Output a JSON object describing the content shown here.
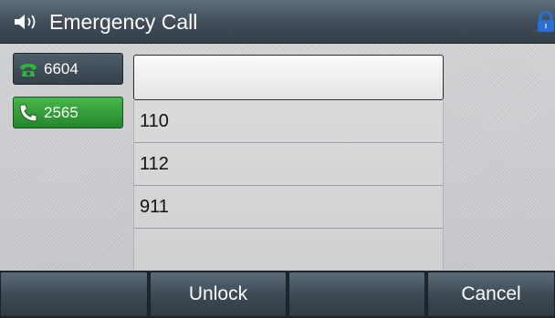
{
  "header": {
    "title": "Emergency Call",
    "icons": [
      "speaker-icon",
      "lock-icon"
    ]
  },
  "line_keys": [
    {
      "number": "6604",
      "icon": "phone-handset-icon",
      "state": "idle",
      "color": "#3a4853"
    },
    {
      "number": "2565",
      "icon": "phone-handset-icon",
      "state": "active",
      "color": "#2f9d35"
    }
  ],
  "dial": {
    "input_value": "",
    "emergency_numbers": [
      "110",
      "112",
      "911"
    ]
  },
  "softkeys": [
    "",
    "Unlock",
    "",
    "Cancel"
  ],
  "colors": {
    "accent_green": "#2f9d35",
    "lock_blue": "#2a6fd6"
  }
}
